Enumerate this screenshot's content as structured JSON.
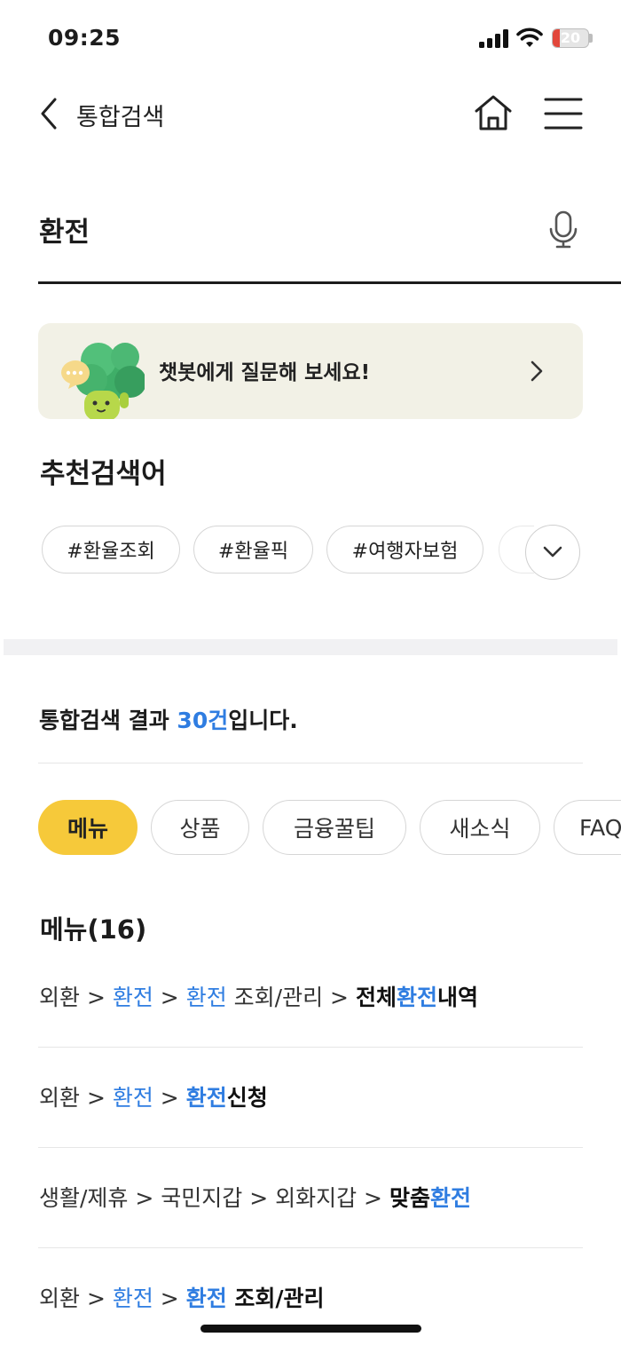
{
  "status_bar": {
    "time": "09:25",
    "battery_percent": 20,
    "battery_label": "20"
  },
  "header": {
    "title": "통합검색"
  },
  "search": {
    "value": "환전",
    "placeholder": ""
  },
  "chatbot": {
    "text": "챗봇에게 질문해 보세요!"
  },
  "recommended": {
    "title": "추천검색어",
    "keywords": [
      "#환율조회",
      "#환율픽",
      "#여행자보험"
    ]
  },
  "results": {
    "summary_prefix": "통합검색 결과 ",
    "summary_count": "30건",
    "summary_suffix": "입니다."
  },
  "tabs": [
    "메뉴",
    "상품",
    "금융꿀팁",
    "새소식",
    "FAQ"
  ],
  "active_tab": "메뉴",
  "menu_section": {
    "title": "메뉴(16)"
  },
  "menu_results": [
    {
      "segments": [
        "외환 > ",
        "환전",
        " > ",
        "환전",
        " 조회/관리 > ",
        "전체",
        "환전",
        "내역"
      ]
    },
    {
      "segments": [
        "외환 > ",
        "환전",
        " > ",
        "환전",
        "신청"
      ]
    },
    {
      "segments": [
        "생활/제휴 > 국민지갑 > 외화지갑 > ",
        "맞춤",
        "환전"
      ]
    },
    {
      "segments": [
        "외환 > ",
        "환전",
        " > ",
        "환전",
        " 조회/관리"
      ]
    }
  ],
  "colors": {
    "accent_yellow": "#f6c93a",
    "highlight_blue": "#2f7de1",
    "banner_bg": "#f2f1e6"
  }
}
